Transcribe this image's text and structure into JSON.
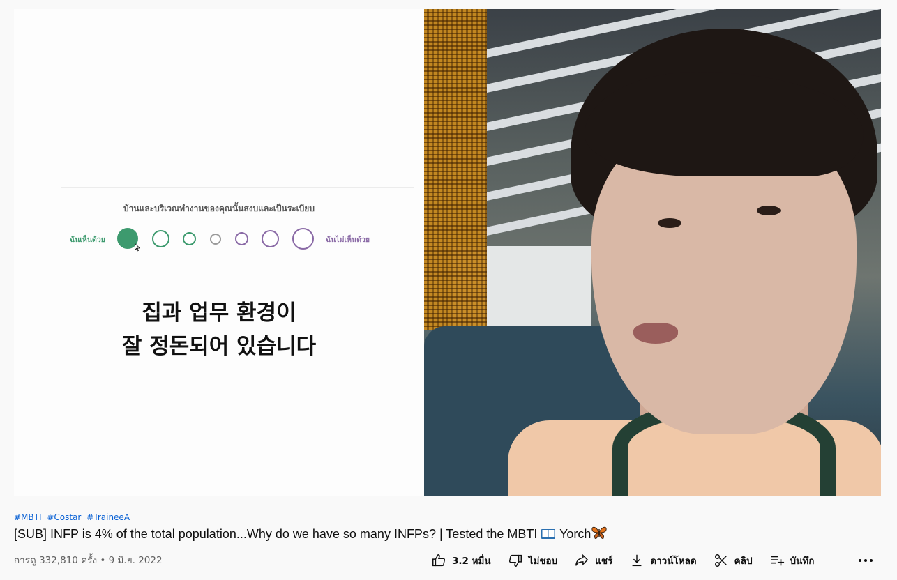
{
  "video": {
    "quiz_question": "บ้านและบริเวณทำงานของคุณนั้นสงบและเป็นระเบียบ",
    "agree_label": "ฉันเห็นด้วย",
    "disagree_label": "ฉันไม่เห็นด้วย",
    "korean_line1": "집과 업무 환경이",
    "korean_line2": "잘 정돈되어 있습니다",
    "colors": {
      "agree": "#3d9a6e",
      "disagree": "#8a6aa6"
    }
  },
  "hashtags": [
    "#MBTI",
    "#Costar",
    "#TraineeA"
  ],
  "title": {
    "text": "[SUB] INFP is 4% of the total population...Why do we have so many INFPs? | Tested the MBTI",
    "suffix": "Yorch",
    "book_icon": "open-book-emoji",
    "butterfly_icon": "butterfly-emoji"
  },
  "meta": {
    "views": "การดู 332,810 ครั้ง",
    "separator": "•",
    "date": "9 มิ.ย. 2022"
  },
  "actions": {
    "like": "3.2 หมื่น",
    "dislike": "ไม่ชอบ",
    "share": "แชร์",
    "download": "ดาวน์โหลด",
    "clip": "คลิป",
    "save": "บันทึก"
  }
}
